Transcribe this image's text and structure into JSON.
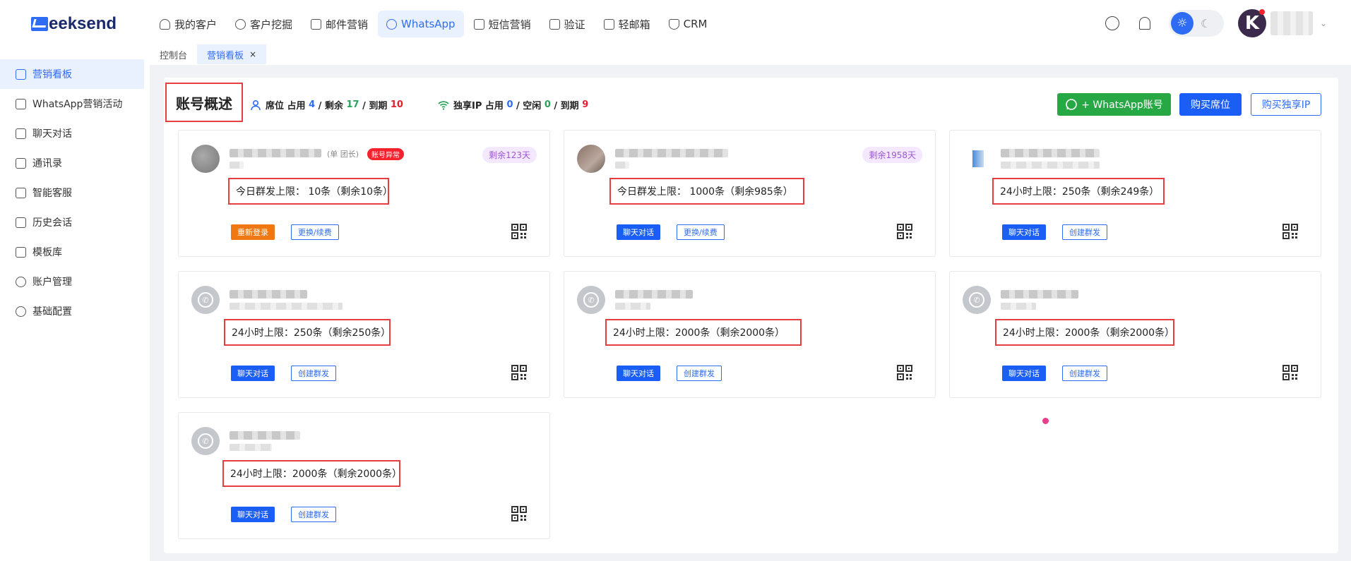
{
  "brand": {
    "name": "Geeksend",
    "wordmark": "eeksend"
  },
  "nav": [
    {
      "label": "我的客户",
      "icon": "user-icon",
      "active": false
    },
    {
      "label": "客户挖掘",
      "icon": "search-icon",
      "active": false
    },
    {
      "label": "邮件营销",
      "icon": "mail-icon",
      "active": false
    },
    {
      "label": "WhatsApp",
      "icon": "whatsapp-icon",
      "active": true
    },
    {
      "label": "短信营销",
      "icon": "sms-icon",
      "active": false
    },
    {
      "label": "验证",
      "icon": "verify-icon",
      "active": false
    },
    {
      "label": "轻邮箱",
      "icon": "light-mail-icon",
      "active": false
    },
    {
      "label": "CRM",
      "icon": "shield-icon",
      "active": false
    }
  ],
  "tabs": [
    {
      "label": "控制台",
      "active": false
    },
    {
      "label": "营销看板",
      "active": true,
      "close": "×"
    }
  ],
  "sidebar": [
    {
      "label": "营销看板",
      "icon": "calendar-icon",
      "active": true
    },
    {
      "label": "WhatsApp营销活动",
      "icon": "campaign-icon",
      "active": false
    },
    {
      "label": "聊天对话",
      "icon": "chat-icon",
      "active": false
    },
    {
      "label": "通讯录",
      "icon": "contacts-icon",
      "active": false
    },
    {
      "label": "智能客服",
      "icon": "robot-icon",
      "active": false
    },
    {
      "label": "历史会话",
      "icon": "history-icon",
      "active": false
    },
    {
      "label": "模板库",
      "icon": "template-icon",
      "active": false
    },
    {
      "label": "账户管理",
      "icon": "account-icon",
      "active": false
    },
    {
      "label": "基础配置",
      "icon": "gear-icon",
      "active": false
    }
  ],
  "overview": {
    "title": "账号概述",
    "seats": {
      "label": "席位 占用",
      "used": "4",
      "remain_label": "/ 剩余",
      "remain": "17",
      "expire_label": "/ 到期",
      "expire": "10"
    },
    "ip": {
      "label": "独享IP 占用",
      "used": "0",
      "idle_label": "/ 空闲",
      "idle": "0",
      "expire_label": "/ 到期",
      "expire": "9"
    },
    "buttons": {
      "add_account": "+ WhatsApp账号",
      "buy_seat": "购买席位",
      "buy_ip": "购买独享IP"
    }
  },
  "colors": {
    "accent": "#2f6cf6",
    "green": "#28a745",
    "red": "#e53e3e"
  },
  "avatar_letter": "K",
  "cards": [
    {
      "role": "(单 团长)",
      "badge": "账号异常",
      "days": "剩余123天",
      "limit": "今日群发上限： 10条（剩余10条）",
      "btn1": "重新登录",
      "btn1_style": "orange",
      "btn2": "更换/续费"
    },
    {
      "role": "",
      "badge": "",
      "days": "剩余1958天",
      "limit": "今日群发上限： 1000条（剩余985条）",
      "btn1": "聊天对话",
      "btn1_style": "blue",
      "btn2": "更换/续费"
    },
    {
      "role": "",
      "badge": "",
      "days": "",
      "limit": "24小时上限：250条（剩余249条）",
      "btn1": "聊天对话",
      "btn1_style": "blue",
      "btn2": "创建群发"
    },
    {
      "role": "",
      "badge": "",
      "days": "",
      "limit": "24小时上限：250条（剩余250条）",
      "btn1": "聊天对话",
      "btn1_style": "blue",
      "btn2": "创建群发"
    },
    {
      "role": "",
      "badge": "",
      "days": "",
      "limit": "24小时上限：2000条（剩余2000条）",
      "btn1": "聊天对话",
      "btn1_style": "blue",
      "btn2": "创建群发"
    },
    {
      "role": "",
      "badge": "",
      "days": "",
      "limit": "24小时上限：2000条（剩余2000条）",
      "btn1": "聊天对话",
      "btn1_style": "blue",
      "btn2": "创建群发"
    },
    {
      "role": "",
      "badge": "",
      "days": "",
      "limit": "24小时上限：2000条（剩余2000条）",
      "btn1": "聊天对话",
      "btn1_style": "blue",
      "btn2": "创建群发"
    }
  ]
}
